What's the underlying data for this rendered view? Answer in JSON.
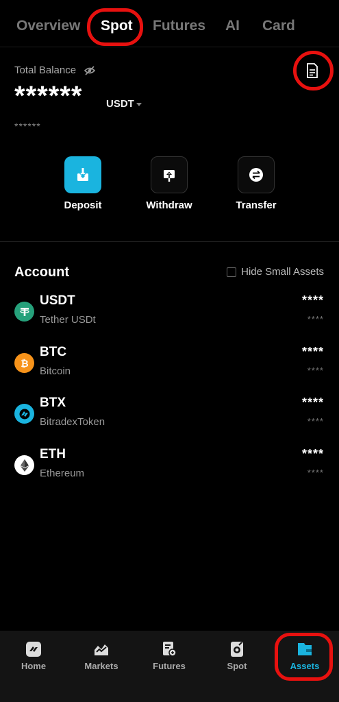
{
  "tabs": [
    "Overview",
    "Spot",
    "Futures",
    "AI",
    "Card"
  ],
  "balance": {
    "label": "Total Balance",
    "value": "******",
    "currency": "USDT",
    "sub_value": "******"
  },
  "actions": {
    "deposit": "Deposit",
    "withdraw": "Withdraw",
    "transfer": "Transfer"
  },
  "account": {
    "title": "Account",
    "hide_small": "Hide Small Assets",
    "assets": [
      {
        "symbol": "USDT",
        "name": "Tether USDt",
        "amount": "****",
        "value": "****",
        "color": "#26a17b"
      },
      {
        "symbol": "BTC",
        "name": "Bitcoin",
        "amount": "****",
        "value": "****",
        "color": "#f7931a"
      },
      {
        "symbol": "BTX",
        "name": "BitradexToken",
        "amount": "****",
        "value": "****",
        "color": "#1ab4df"
      },
      {
        "symbol": "ETH",
        "name": "Ethereum",
        "amount": "****",
        "value": "****",
        "color": "#ffffff"
      }
    ]
  },
  "bottom_nav": [
    "Home",
    "Markets",
    "Futures",
    "Spot",
    "Assets"
  ],
  "colors": {
    "accent": "#1ab4df",
    "highlight": "#e8110f"
  }
}
